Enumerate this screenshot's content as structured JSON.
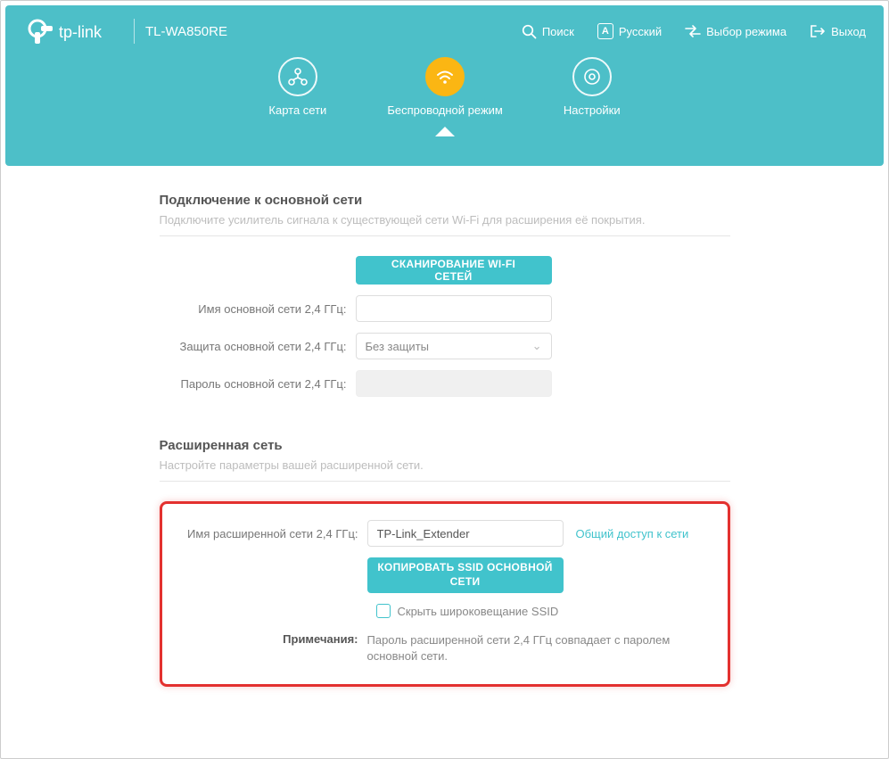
{
  "brand": "tp-link",
  "model": "TL-WA850RE",
  "topnav": {
    "search": "Поиск",
    "lang_letter": "А",
    "lang": "Русский",
    "mode": "Выбор режима",
    "logout": "Выход"
  },
  "tabs": {
    "map": "Карта сети",
    "wireless": "Беспроводной режим",
    "settings": "Настройки"
  },
  "section_host": {
    "title": "Подключение к основной сети",
    "subtitle": "Подключите усилитель сигнала к существующей сети Wi-Fi для расширения её покрытия.",
    "scan_btn": "СКАНИРОВАНИЕ WI-FI СЕТЕЙ",
    "ssid_label": "Имя основной сети 2,4 ГГц:",
    "ssid_value": "",
    "security_label": "Защита основной сети 2,4 ГГц:",
    "security_value": "Без защиты",
    "password_label": "Пароль основной сети 2,4 ГГц:",
    "password_value": ""
  },
  "section_ext": {
    "title": "Расширенная сеть",
    "subtitle": "Настройте параметры вашей расширенной сети.",
    "ssid_label": "Имя расширенной сети 2,4 ГГц:",
    "ssid_value": "TP-Link_Extender",
    "share_link": "Общий доступ к сети",
    "copy_btn": "КОПИРОВАТЬ SSID ОСНОВНОЙ СЕТИ",
    "hide_ssid": "Скрыть широковещание SSID",
    "note_label": "Примечания:",
    "note_text": "Пароль расширенной сети 2,4 ГГц совпадает с паролем основной сети."
  }
}
